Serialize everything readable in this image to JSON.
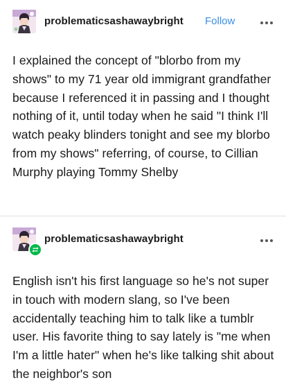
{
  "post1": {
    "username": "problematicsashawaybright",
    "follow_label": "Follow",
    "more_icon": "ellipsis-icon",
    "body": "I explained the concept of \"blorbo from my shows\" to my 71 year old immigrant grandfather because I referenced it in passing and I thought nothing of it, until today when he said \"I think I'll watch peaky blinders tonight and see my blorbo from my shows\" referring, of course, to Cillian Murphy playing Tommy Shelby"
  },
  "post2": {
    "username": "problematicsashawaybright",
    "more_icon": "ellipsis-icon",
    "reblog_icon": "reblog-icon",
    "body": "English isn't his first language so he's not super in touch with modern slang, so I've been accidentally teaching him to talk like a tumblr user. His favorite thing to say lately is \"me when I'm a little hater\" when he's like talking shit about the neighbor's son"
  },
  "colors": {
    "follow": "#3a8ee6",
    "reblog_badge": "#00b84a",
    "text": "#1a1a1a",
    "divider": "#e0e0e0"
  }
}
